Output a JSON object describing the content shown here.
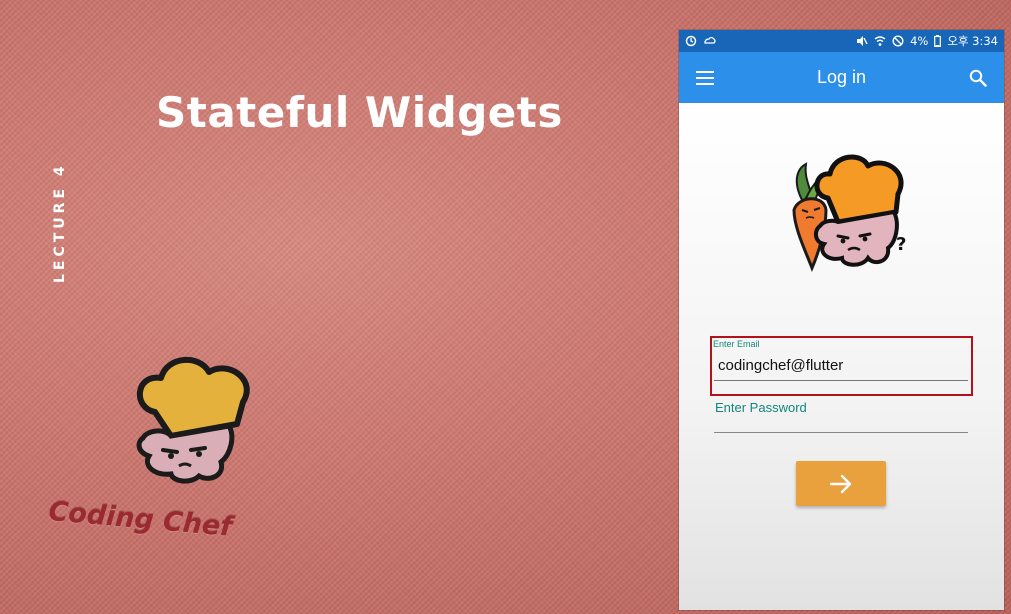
{
  "slide": {
    "title": "Stateful Widgets",
    "lecture_label": "LECTURE 4",
    "brand_text": "Coding Chef"
  },
  "phone": {
    "status_bar": {
      "battery": "4%",
      "time": "오후 3:34"
    },
    "app_bar": {
      "title": "Log in",
      "left_icon": "menu-icon",
      "right_icon": "search-icon"
    },
    "form": {
      "email_label": "Enter Email",
      "email_value": "codingchef@flutter",
      "password_label": "Enter Password",
      "submit_icon": "arrow-right-icon"
    }
  },
  "colors": {
    "app_bar": "#2c8fe9",
    "status_bar": "#1766b8",
    "accent_teal": "#12877a",
    "button_orange": "#e8a13d",
    "highlight_red": "#b3121d",
    "fabric": "#c9726a"
  }
}
